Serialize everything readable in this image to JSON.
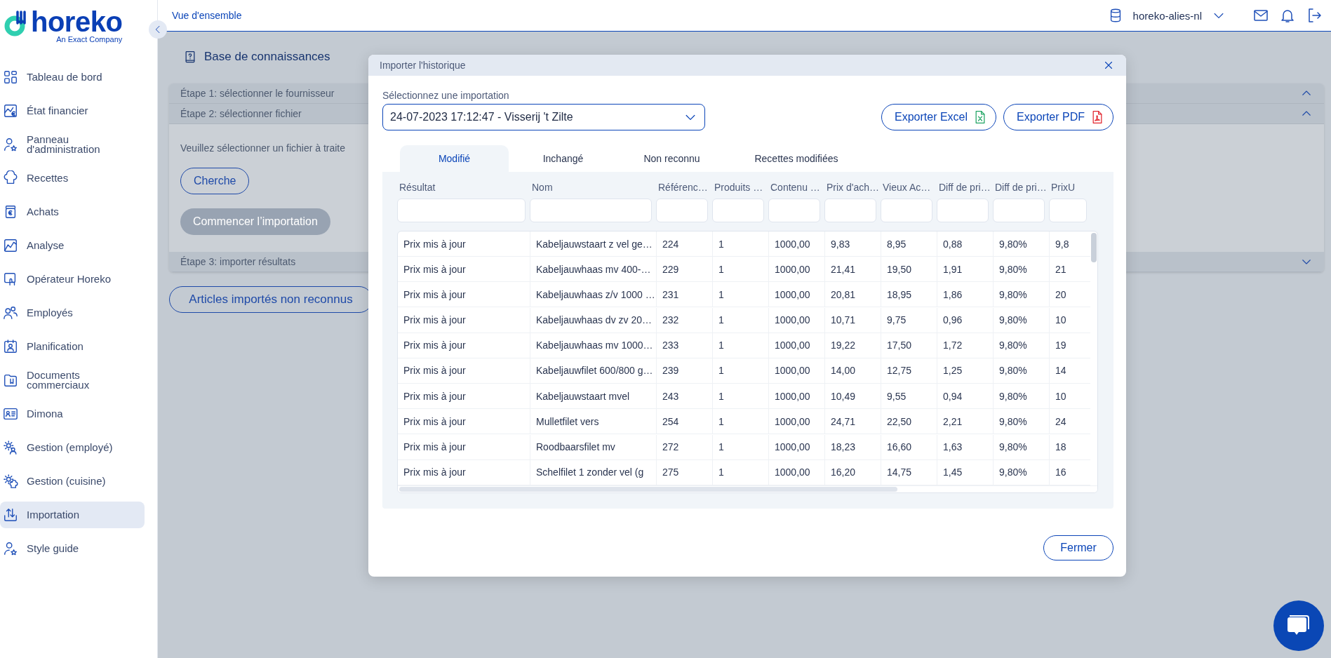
{
  "logo": {
    "name": "horeko",
    "tagline": "An Exact Company"
  },
  "sidebar": {
    "items": [
      {
        "label": "Tableau de bord",
        "selected": false
      },
      {
        "label": "État financier",
        "selected": false
      },
      {
        "label": "Panneau d'administration",
        "selected": false
      },
      {
        "label": "Recettes",
        "selected": false
      },
      {
        "label": "Achats",
        "selected": false
      },
      {
        "label": "Analyse",
        "selected": false
      },
      {
        "label": "Opérateur Horeko",
        "selected": false
      },
      {
        "label": "Employés",
        "selected": false
      },
      {
        "label": "Planification",
        "selected": false
      },
      {
        "label": "Documents commerciaux",
        "selected": false
      },
      {
        "label": "Dimona",
        "selected": false
      },
      {
        "label": "Gestion (employé)",
        "selected": false
      },
      {
        "label": "Gestion (cuisine)",
        "selected": false
      },
      {
        "label": "Importation",
        "selected": true
      },
      {
        "label": "Style guide",
        "selected": false
      }
    ]
  },
  "topbar": {
    "breadcrumb": "Vue d'ensemble",
    "account": "horeko-alies-nl"
  },
  "page": {
    "title": "Base de connaissances",
    "steps": [
      {
        "label": "Étape 1: sélectionner le fournisseur",
        "expanded": true
      },
      {
        "label": "Étape 2: sélectionner fichier",
        "expanded": true,
        "body": {
          "instruction": "Veuillez sélectionner un fichier à traite",
          "browse_button": "Cherche",
          "start_button": {
            "label": "Commencer l’importation",
            "disabled": true
          }
        }
      },
      {
        "label": "Étape 3: importer résultats",
        "expanded": false
      }
    ],
    "unrecognized_button": "Articles importés non reconnus"
  },
  "modal": {
    "title": "Importer l'historique",
    "select": {
      "label": "Sélectionnez une importation",
      "value": "24-07-2023 17:12:47 - Visserij 't Zilte"
    },
    "export_buttons": [
      {
        "label": "Exporter Excel",
        "kind": "excel"
      },
      {
        "label": "Exporter PDF",
        "kind": "pdf"
      }
    ],
    "tabs": [
      {
        "label": "Modifié",
        "selected": true
      },
      {
        "label": "Inchangé",
        "selected": false
      },
      {
        "label": "Non reconnu",
        "selected": false
      },
      {
        "label": "Recettes modifiées",
        "selected": false
      }
    ],
    "table": {
      "columns": [
        "Résultat",
        "Nom",
        "Référenc…",
        "Produits …",
        "Contenu …",
        "Prix d'ach…",
        "Vieux Ac…",
        "Diff de pri…",
        "Diff de pri…",
        "PrixU"
      ],
      "rows": [
        [
          "Prix mis à jour",
          "Kabeljauwstaart z vel ge…",
          "224",
          "1",
          "1000,00",
          "9,83",
          "8,95",
          "0,88",
          "9,80%",
          "9,8"
        ],
        [
          "Prix mis à jour",
          "Kabeljauwhaas mv 400-…",
          "229",
          "1",
          "1000,00",
          "21,41",
          "19,50",
          "1,91",
          "9,80%",
          "21"
        ],
        [
          "Prix mis à jour",
          "Kabeljauwhaas z/v 1000 …",
          "231",
          "1",
          "1000,00",
          "20,81",
          "18,95",
          "1,86",
          "9,80%",
          "20"
        ],
        [
          "Prix mis à jour",
          "Kabeljauwhaas dv zv 20…",
          "232",
          "1",
          "1000,00",
          "10,71",
          "9,75",
          "0,96",
          "9,80%",
          "10"
        ],
        [
          "Prix mis à jour",
          "Kabeljauwhaas mv 1000…",
          "233",
          "1",
          "1000,00",
          "19,22",
          "17,50",
          "1,72",
          "9,80%",
          "19"
        ],
        [
          "Prix mis à jour",
          "Kabeljauwfilet 600/800 g…",
          "239",
          "1",
          "1000,00",
          "14,00",
          "12,75",
          "1,25",
          "9,80%",
          "14"
        ],
        [
          "Prix mis à jour",
          "Kabeljauwstaart mvel",
          "243",
          "1",
          "1000,00",
          "10,49",
          "9,55",
          "0,94",
          "9,80%",
          "10"
        ],
        [
          "Prix mis à jour",
          "Mulletfilet vers",
          "254",
          "1",
          "1000,00",
          "24,71",
          "22,50",
          "2,21",
          "9,80%",
          "24"
        ],
        [
          "Prix mis à jour",
          "Roodbaarsfilet mv",
          "272",
          "1",
          "1000,00",
          "18,23",
          "16,60",
          "1,63",
          "9,80%",
          "18"
        ],
        [
          "Prix mis à jour",
          "Schelfilet 1 zonder vel (g",
          "275",
          "1",
          "1000,00",
          "16,20",
          "14,75",
          "1,45",
          "9,80%",
          "16"
        ]
      ]
    },
    "close_button": "Fermer"
  }
}
